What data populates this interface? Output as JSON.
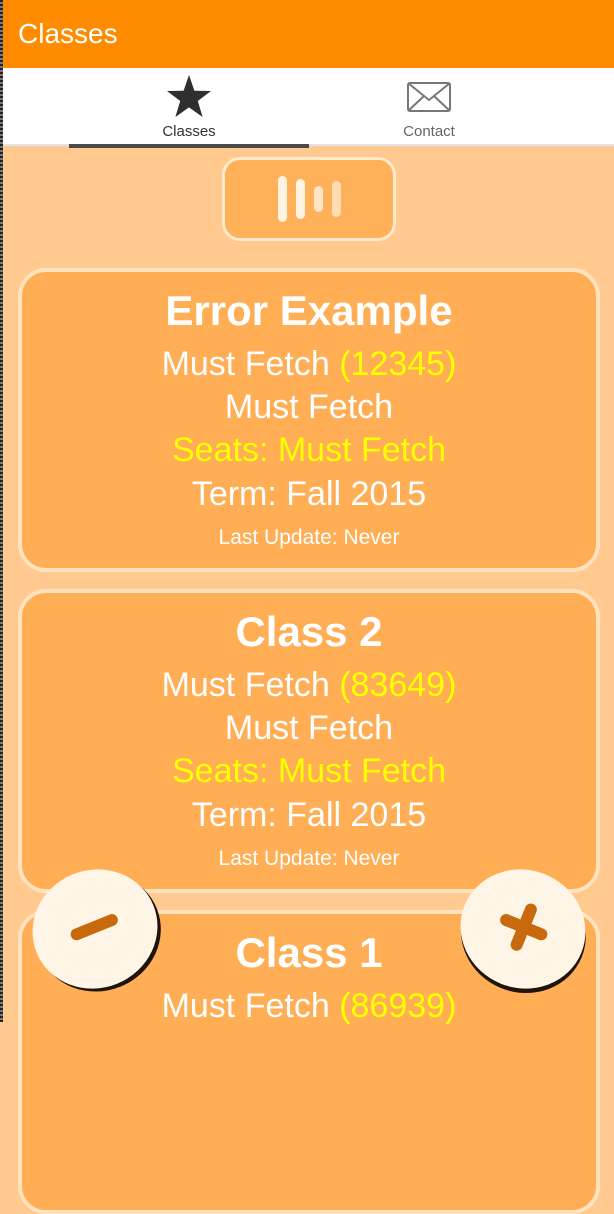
{
  "app_bar": {
    "title": "Classes"
  },
  "tabs": [
    {
      "label": "Classes",
      "icon": "star-icon",
      "selected": true
    },
    {
      "label": "Contact",
      "icon": "envelope-icon",
      "selected": false
    }
  ],
  "toolbar": {
    "toggle_icon": "vertical-bars-icon"
  },
  "classes": [
    {
      "title": "Error Example",
      "name_prefix": "Must Fetch",
      "id": "(12345)",
      "name": "Must Fetch",
      "seats": "Seats: Must Fetch",
      "term": "Term: Fall 2015",
      "last_update": "Last Update: Never"
    },
    {
      "title": "Class 2",
      "name_prefix": "Must Fetch",
      "id": "(83649)",
      "name": "Must Fetch",
      "seats": "Seats: Must Fetch",
      "term": "Term: Fall 2015",
      "last_update": "Last Update: Never"
    },
    {
      "title": "Class 1",
      "name_prefix": "Must Fetch",
      "id": "(86939)",
      "name": "",
      "seats": "",
      "term": "",
      "last_update": ""
    }
  ],
  "actions": {
    "remove_icon": "minus-icon",
    "add_icon": "plus-icon"
  },
  "colors": {
    "app_bar": "#ff8c00",
    "background": "#ffc98f",
    "card": "#ffae55",
    "card_border": "#ffe3bf",
    "highlight": "#ffff00",
    "fab_icon": "#c8690e"
  }
}
